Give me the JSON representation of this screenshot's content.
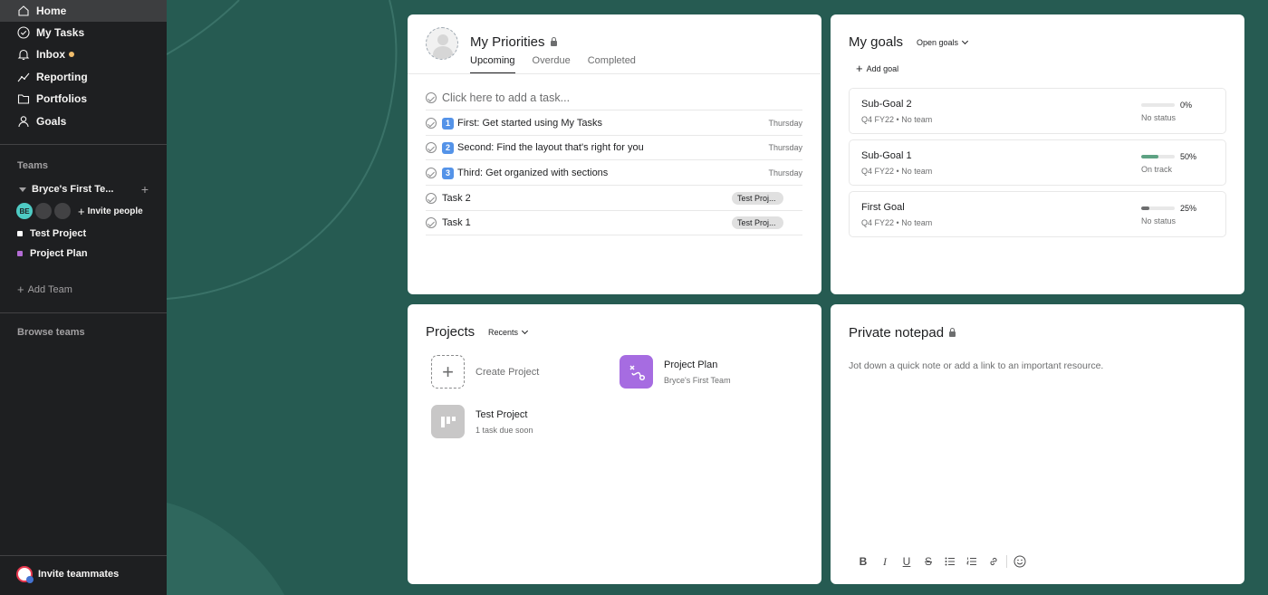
{
  "sidebar": {
    "nav": [
      {
        "label": "Home",
        "icon": "home-icon"
      },
      {
        "label": "My Tasks",
        "icon": "check-circle-icon"
      },
      {
        "label": "Inbox",
        "icon": "bell-icon"
      },
      {
        "label": "Reporting",
        "icon": "line-chart-icon"
      },
      {
        "label": "Portfolios",
        "icon": "folder-icon"
      },
      {
        "label": "Goals",
        "icon": "person-icon"
      }
    ],
    "teams_label": "Teams",
    "team_name": "Bryce's First Te...",
    "avatar_initials": "BE",
    "invite_people_label": "Invite people",
    "projects": [
      {
        "label": "Test Project",
        "color": "#ffffff"
      },
      {
        "label": "Project Plan",
        "color": "#b36bd4"
      }
    ],
    "add_team_label": "Add Team",
    "browse_teams_label": "Browse teams",
    "invite_teammates_label": "Invite teammates"
  },
  "priorities": {
    "title": "My Priorities",
    "tabs": [
      "Upcoming",
      "Overdue",
      "Completed"
    ],
    "add_task_label": "Click here to add a task...",
    "tasks": [
      {
        "badge": "1",
        "label": "First: Get started using My Tasks",
        "due": "Thursday"
      },
      {
        "badge": "2",
        "label": "Second: Find the layout that's right for you",
        "due": "Thursday"
      },
      {
        "badge": "3",
        "label": "Third: Get organized with sections",
        "due": "Thursday"
      },
      {
        "label": "Task 2",
        "tag": "Test Proj..."
      },
      {
        "label": "Task 1",
        "tag": "Test Proj..."
      }
    ]
  },
  "goals": {
    "title": "My goals",
    "filter_label": "Open goals",
    "add_goal_label": "Add goal",
    "items": [
      {
        "name": "Sub-Goal 2",
        "period": "Q4 FY22",
        "team": "No team",
        "percent_label": "0%",
        "progress": 0,
        "status": "No status",
        "bar_color": "#d5d5d5"
      },
      {
        "name": "Sub-Goal 1",
        "period": "Q4 FY22",
        "team": "No team",
        "percent_label": "50%",
        "progress": 0.5,
        "status": "On track",
        "bar_color": "#5da283"
      },
      {
        "name": "First Goal",
        "period": "Q4 FY22",
        "team": "No team",
        "percent_label": "25%",
        "progress": 0.25,
        "status": "No status",
        "bar_color": "#6d6e6f"
      }
    ],
    "separator": "•"
  },
  "projects": {
    "title": "Projects",
    "filter_label": "Recents",
    "create_label": "Create Project",
    "items": [
      {
        "name": "Project Plan",
        "sub": "Bryce's First Team",
        "color": "#a66ce1",
        "icon": "journey-icon"
      },
      {
        "name": "Test Project",
        "sub": "1 task due soon",
        "color": "#c8c7c7",
        "icon": "board-icon"
      }
    ]
  },
  "notepad": {
    "title": "Private notepad",
    "placeholder": "Jot down a quick note or add a link to an important resource.",
    "toolbar": [
      {
        "label": "B",
        "icon": "bold-icon"
      },
      {
        "label": "I",
        "icon": "italic-icon"
      },
      {
        "label": "U",
        "icon": "underline-icon"
      },
      {
        "label": "S",
        "icon": "strikethrough-icon"
      },
      {
        "label": "",
        "icon": "bulleted-list-icon"
      },
      {
        "label": "",
        "icon": "numbered-list-icon"
      },
      {
        "label": "",
        "icon": "link-icon"
      },
      {
        "label": "",
        "icon": "emoji-icon"
      }
    ]
  },
  "colors": {
    "background": "#265b52",
    "sidebar": "#1e1f21",
    "sidebar_active": "#3d3e40",
    "inbox_dot": "#f1bd6c",
    "avatar_be": "#4ecbc4"
  }
}
